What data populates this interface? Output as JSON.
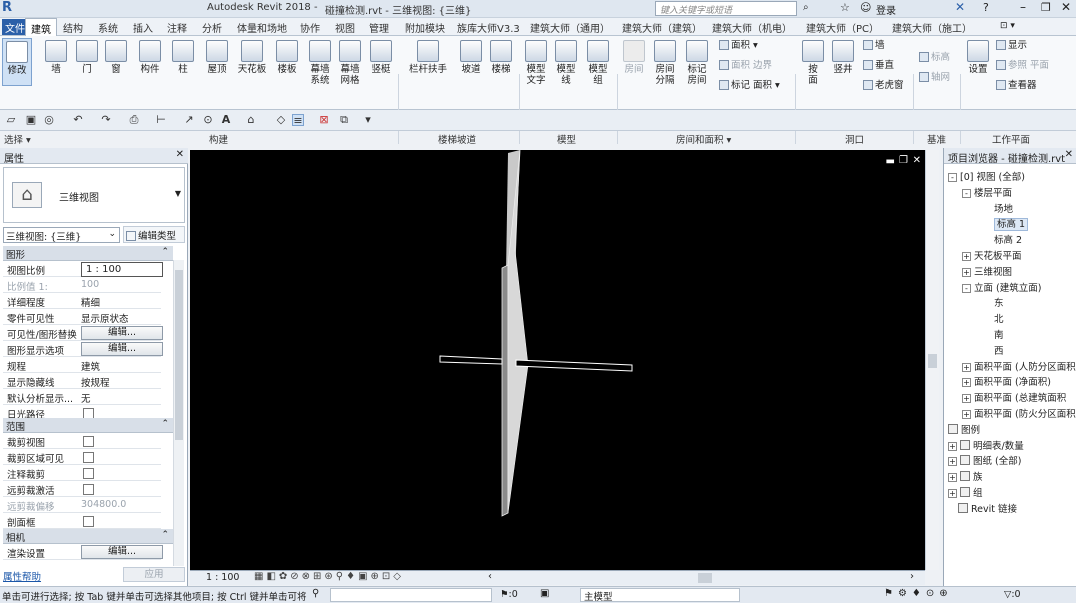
{
  "titlebar": {
    "app_title": "Autodesk Revit 2018 -",
    "doc_title": "碰撞检测.rvt - 三维视图: {三维}",
    "search_placeholder": "键入关键字或短语",
    "login_label": "登录"
  },
  "tabs": [
    "文件",
    "建筑",
    "结构",
    "系统",
    "插入",
    "注释",
    "分析",
    "体量和场地",
    "协作",
    "视图",
    "管理",
    "附加模块",
    "族库大师V3.3",
    "建筑大师（通用）",
    "建筑大师（建筑）",
    "建筑大师（机电）",
    "建筑大师（PC）",
    "建筑大师（施工）"
  ],
  "ribbon": {
    "modify": "修改",
    "select": "选择 ▾",
    "build": {
      "items": [
        "墙",
        "门",
        "窗",
        "构件",
        "柱",
        "屋顶",
        "天花板",
        "楼板",
        "幕墙\n系统",
        "幕墙\n网格",
        "竖梃"
      ],
      "panel": "构建"
    },
    "stairs": {
      "items": [
        "栏杆扶手",
        "坡道",
        "楼梯"
      ],
      "panel": "楼梯坡道"
    },
    "model": {
      "items": [
        "模型\n文字",
        "模型\n线",
        "模型\n组"
      ],
      "panel": "模型"
    },
    "room": {
      "items": [
        "房间",
        "房间\n分隔",
        "标记\n房间"
      ],
      "small": [
        "面积 ▾",
        "面积  边界",
        "标记  面积 ▾"
      ],
      "panel": "房间和面积 ▾"
    },
    "opening": {
      "items": [
        "按\n面",
        "竖井"
      ],
      "small": [
        "墙",
        "垂直",
        "老虎窗"
      ],
      "panel": "洞口"
    },
    "datum": {
      "small": [
        "标高",
        "轴网"
      ],
      "panel": "基准"
    },
    "workplane": {
      "items": [
        "设置"
      ],
      "small": [
        "显示",
        "参照 平面",
        "查看器"
      ],
      "panel": "工作平面"
    }
  },
  "properties": {
    "header": "属性",
    "type_name": "三维视图",
    "selector": "三维视图: {三维}",
    "edit_type": "编辑类型",
    "sections": {
      "graphics": "图形",
      "extents": "范围",
      "camera": "相机"
    },
    "rows_graphics": [
      {
        "k": "视图比例",
        "v": "1 : 100",
        "kind": "input"
      },
      {
        "k": "比例值 1:",
        "v": "100",
        "kind": "dim"
      },
      {
        "k": "详细程度",
        "v": "精细",
        "kind": "text"
      },
      {
        "k": "零件可见性",
        "v": "显示原状态",
        "kind": "text"
      },
      {
        "k": "可见性/图形替换",
        "v": "编辑...",
        "kind": "btn"
      },
      {
        "k": "图形显示选项",
        "v": "编辑...",
        "kind": "btn"
      },
      {
        "k": "规程",
        "v": "建筑",
        "kind": "text"
      },
      {
        "k": "显示隐藏线",
        "v": "按规程",
        "kind": "text"
      },
      {
        "k": "默认分析显示...",
        "v": "无",
        "kind": "text"
      },
      {
        "k": "日光路径",
        "v": "",
        "kind": "cb"
      }
    ],
    "rows_extents": [
      {
        "k": "裁剪视图",
        "v": "",
        "kind": "cb"
      },
      {
        "k": "裁剪区域可见",
        "v": "",
        "kind": "cb"
      },
      {
        "k": "注释裁剪",
        "v": "",
        "kind": "cb"
      },
      {
        "k": "远剪裁激活",
        "v": "",
        "kind": "cb"
      },
      {
        "k": "远剪裁偏移",
        "v": "304800.0",
        "kind": "dim"
      },
      {
        "k": "剖面框",
        "v": "",
        "kind": "cb"
      }
    ],
    "rows_camera": [
      {
        "k": "渲染设置",
        "v": "编辑...",
        "kind": "btn"
      }
    ],
    "help": "属性帮助",
    "apply": "应用"
  },
  "viewport": {
    "scale": "1 : 100"
  },
  "browser": {
    "title": "项目浏览器 - 碰撞检测.rvt",
    "nodes": [
      {
        "label": "[0] 视图 (全部)",
        "x": 4,
        "ex": "-"
      },
      {
        "label": "楼层平面",
        "x": 18,
        "ex": "-"
      },
      {
        "label": "场地",
        "x": 50,
        "ex": ""
      },
      {
        "label": "标高 1",
        "x": 50,
        "ex": "",
        "sel": true
      },
      {
        "label": "标高 2",
        "x": 50,
        "ex": ""
      },
      {
        "label": "天花板平面",
        "x": 18,
        "ex": "+"
      },
      {
        "label": "三维视图",
        "x": 18,
        "ex": "+"
      },
      {
        "label": "立面 (建筑立面)",
        "x": 18,
        "ex": "-"
      },
      {
        "label": "东",
        "x": 50,
        "ex": ""
      },
      {
        "label": "北",
        "x": 50,
        "ex": ""
      },
      {
        "label": "南",
        "x": 50,
        "ex": ""
      },
      {
        "label": "西",
        "x": 50,
        "ex": ""
      },
      {
        "label": "面积平面 (人防分区面积",
        "x": 18,
        "ex": "+"
      },
      {
        "label": "面积平面 (净面积)",
        "x": 18,
        "ex": "+"
      },
      {
        "label": "面积平面 (总建筑面积",
        "x": 18,
        "ex": "+"
      },
      {
        "label": "面积平面 (防火分区面积",
        "x": 18,
        "ex": "+"
      },
      {
        "label": "图例",
        "x": 4,
        "ex": "",
        "icon": true
      },
      {
        "label": "明细表/数量",
        "x": 4,
        "ex": "+",
        "icon": true
      },
      {
        "label": "图纸 (全部)",
        "x": 4,
        "ex": "+",
        "icon": true
      },
      {
        "label": "族",
        "x": 4,
        "ex": "+",
        "icon": true
      },
      {
        "label": "组",
        "x": 4,
        "ex": "+",
        "icon": true
      },
      {
        "label": "Revit 链接",
        "x": 14,
        "ex": "",
        "icon": true
      }
    ]
  },
  "status": {
    "message": "单击可进行选择; 按 Tab 键并单击可选择其他项目; 按 Ctrl 键并单击可将",
    "count1": ":0",
    "model": "主模型",
    "count2": ":0"
  },
  "colors": {
    "ribbon_bg": "#f7f9fb",
    "viewport": "#000000",
    "accent": "#2b5fa8"
  }
}
